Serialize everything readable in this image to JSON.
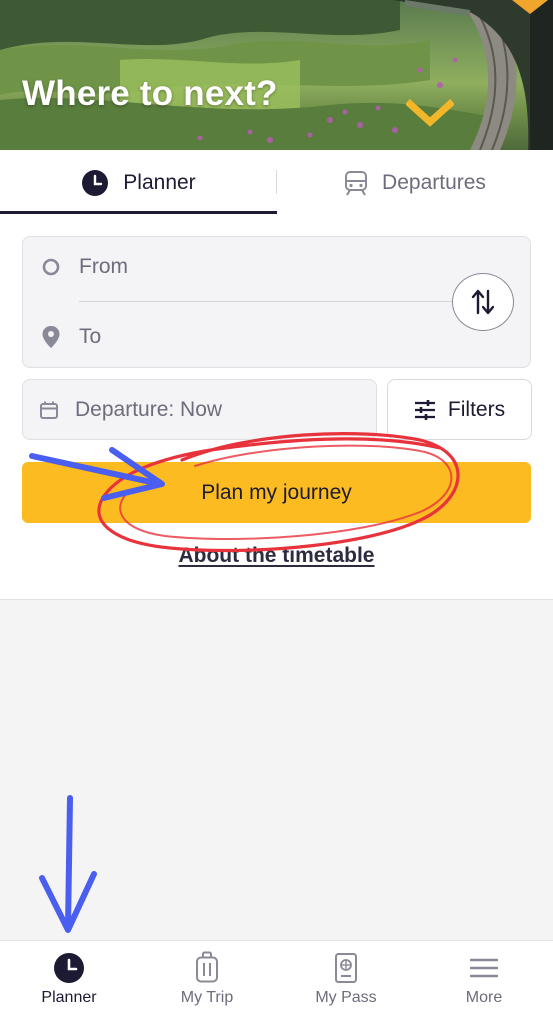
{
  "hero": {
    "title": "Where to next?"
  },
  "tabs": [
    {
      "label": "Planner",
      "icon": "clock-icon",
      "active": true
    },
    {
      "label": "Departures",
      "icon": "train-icon",
      "active": false
    }
  ],
  "route": {
    "from_placeholder": "From",
    "to_placeholder": "To"
  },
  "departure": {
    "label": "Departure: Now"
  },
  "filters": {
    "label": "Filters"
  },
  "plan_button": {
    "label": "Plan my journey"
  },
  "timetable_link": {
    "label": "About the timetable"
  },
  "bottom_nav": [
    {
      "label": "Planner",
      "icon": "clock-icon",
      "active": true
    },
    {
      "label": "My Trip",
      "icon": "luggage-icon",
      "active": false
    },
    {
      "label": "My Pass",
      "icon": "passport-icon",
      "active": false
    },
    {
      "label": "More",
      "icon": "menu-icon",
      "active": false
    }
  ],
  "colors": {
    "accent": "#fbbb21",
    "text_dark": "#1c1b33",
    "text_muted": "#6d6c7c",
    "annotation_red": "#e8323c",
    "annotation_blue": "#4a5ef0"
  }
}
